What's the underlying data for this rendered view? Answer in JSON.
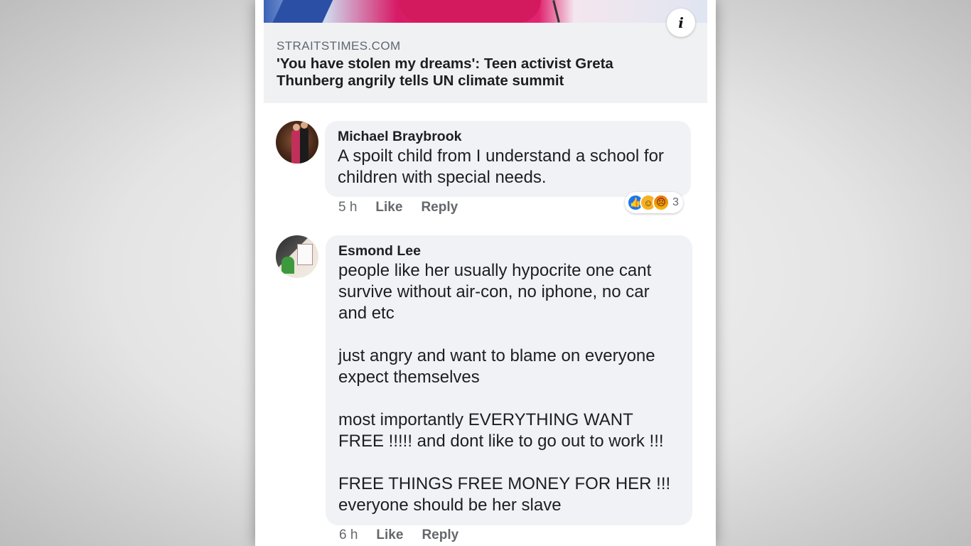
{
  "link_preview": {
    "source": "STRAITSTIMES.COM",
    "headline": "'You have stolen my dreams': Teen activist Greta Thunberg angrily tells UN climate summit",
    "info_icon": "info-icon",
    "info_glyph": "i"
  },
  "comments": [
    {
      "author": "Michael Braybrook",
      "text": "A spoilt child from I understand a school for children with special needs.",
      "time": "5 h",
      "like_label": "Like",
      "reply_label": "Reply",
      "reactions": {
        "icons": [
          "like-icon",
          "haha-icon",
          "angry-icon"
        ],
        "count": "3"
      }
    },
    {
      "author": "Esmond Lee",
      "text": "people like her usually hypocrite one cant survive without air-con, no iphone, no car and etc\n\njust angry and want to blame on everyone expect themselves\n\nmost importantly EVERYTHING WANT FREE !!!!! and dont like to go out to work !!!\n\nFREE THINGS FREE MONEY FOR HER !!!\neveryone should be her slave",
      "time": "6 h",
      "like_label": "Like",
      "reply_label": "Reply"
    }
  ],
  "colors": {
    "bubble_bg": "#f0f2f5",
    "text_primary": "#1c1e21",
    "text_secondary": "#65676b",
    "like_blue": "#1877f2"
  }
}
